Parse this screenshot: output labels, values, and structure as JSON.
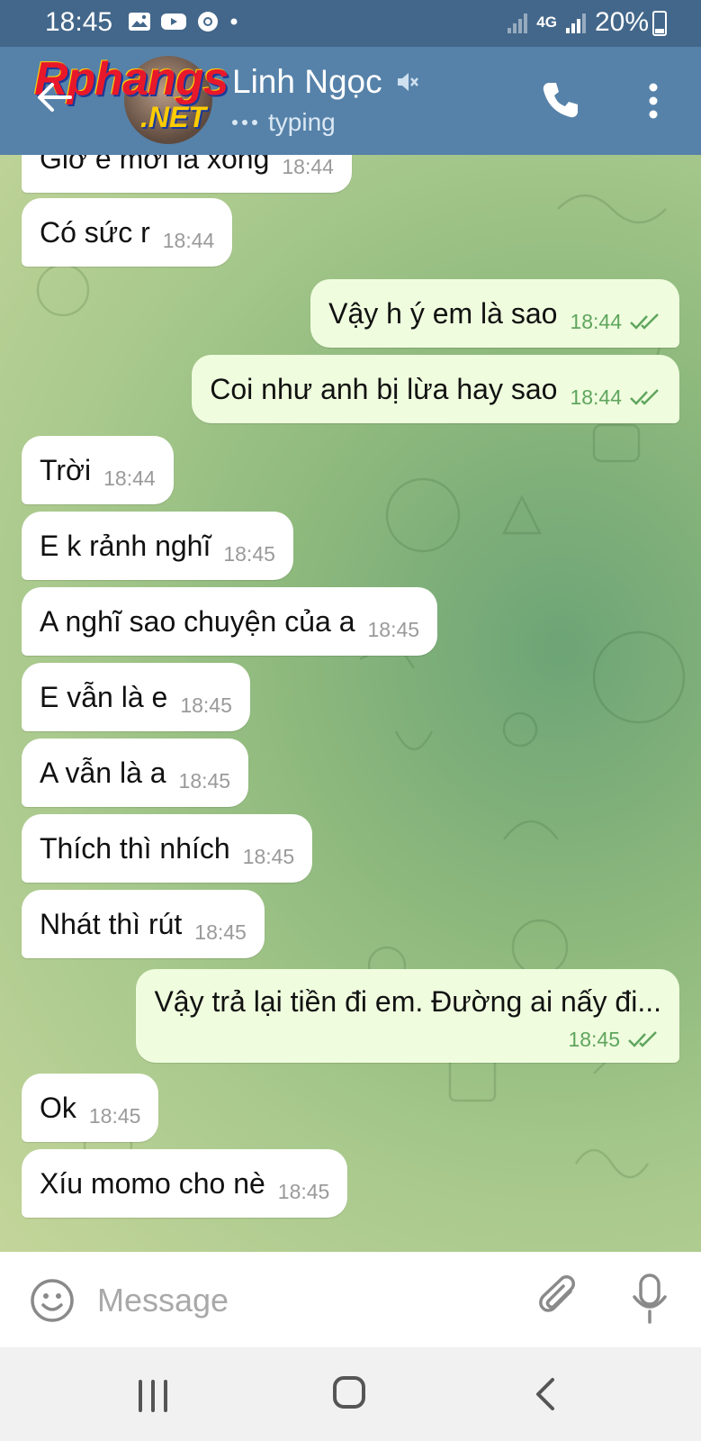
{
  "status_bar": {
    "time": "18:45",
    "network": "4G",
    "battery": "20%",
    "icons": [
      "image-icon",
      "youtube-icon",
      "chrome-icon",
      "dot-icon",
      "signal-icon",
      "data-arrows-icon",
      "signal-icon",
      "battery-icon"
    ]
  },
  "watermark": {
    "text": "Rphangs",
    "sub": ".NET"
  },
  "header": {
    "name": "Linh Ngọc",
    "status": "typing",
    "muted": true
  },
  "messages": [
    {
      "dir": "in",
      "text": "Giờ e mới là xong",
      "time": "18:44"
    },
    {
      "dir": "in",
      "text": "Có sức r",
      "time": "18:44"
    },
    {
      "dir": "out",
      "text": "Vậy h ý em là sao",
      "time": "18:44",
      "read": true
    },
    {
      "dir": "out",
      "text": "Coi như anh bị lừa hay sao",
      "time": "18:44",
      "read": true
    },
    {
      "dir": "in",
      "text": "Trời",
      "time": "18:44"
    },
    {
      "dir": "in",
      "text": "E k rảnh nghĩ",
      "time": "18:45"
    },
    {
      "dir": "in",
      "text": "A nghĩ sao chuyện của a",
      "time": "18:45"
    },
    {
      "dir": "in",
      "text": "E vẫn là e",
      "time": "18:45"
    },
    {
      "dir": "in",
      "text": "A vẫn là a",
      "time": "18:45"
    },
    {
      "dir": "in",
      "text": "Thích thì nhích",
      "time": "18:45"
    },
    {
      "dir": "in",
      "text": "Nhát thì rút",
      "time": "18:45"
    },
    {
      "dir": "out",
      "text": "Vậy trả lại tiền đi em. Đường ai nấy đi...",
      "time": "18:45",
      "read": true
    },
    {
      "dir": "in",
      "text": "Ok",
      "time": "18:45"
    },
    {
      "dir": "in",
      "text": "Xíu momo cho nè",
      "time": "18:45"
    }
  ],
  "input": {
    "placeholder": "Message",
    "value": ""
  },
  "colors": {
    "status_bar": "#43678a",
    "header": "#5682a9",
    "incoming_bubble": "#ffffff",
    "outgoing_bubble": "#effdde",
    "outgoing_time": "#5fa55e",
    "nav_bar": "#f1f1f1"
  }
}
